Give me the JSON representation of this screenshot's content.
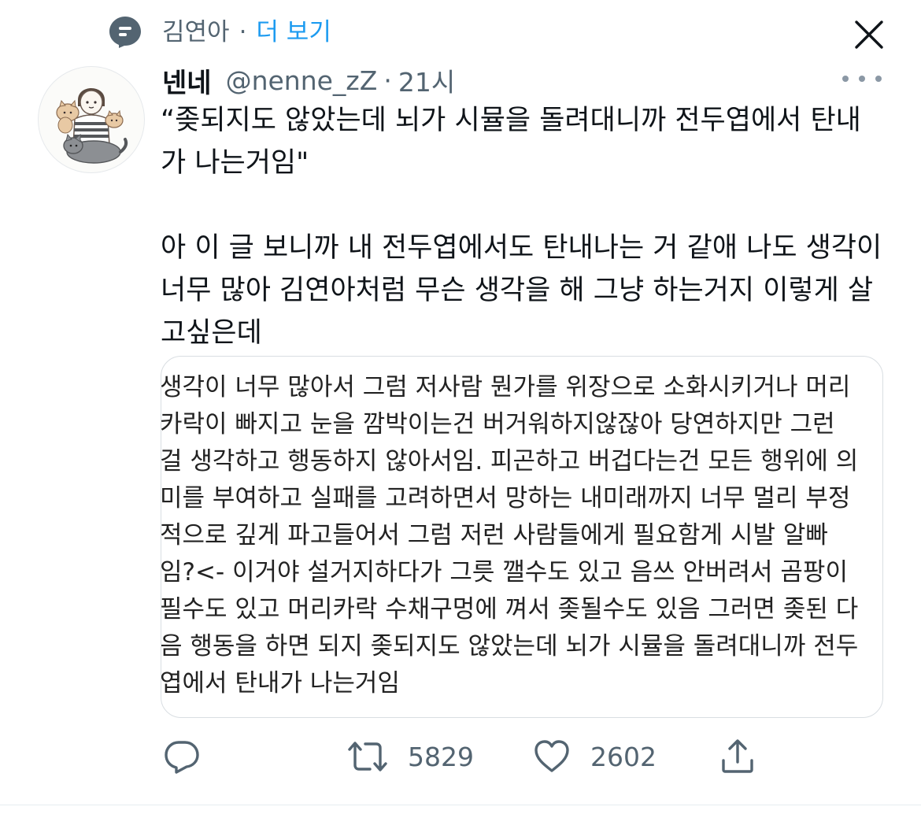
{
  "context": {
    "icon": "topic-icon",
    "name": "김연아",
    "dot": "·",
    "more_label": "더 보기"
  },
  "close": {
    "icon": "close-icon"
  },
  "author": {
    "display_name": "넨네",
    "handle": "@nenne_zZ",
    "separator": "·",
    "time": "21시",
    "avatar": "avatar-illustration"
  },
  "more": {
    "icon": "more-icon"
  },
  "tweet": {
    "paragraph_1": "“좆되지도 않았는데 뇌가 시뮬을 돌려대니까 전두엽에서 탄내가 나는거임\"",
    "paragraph_2": "아 이 글 보니까 내 전두엽에서도 탄내나는 거 같애 나도 생각이 너무 많아 김연아처럼 무슨 생각을 해 그냥 하는거지 이렇게 살고싶은데"
  },
  "media": {
    "lines": [
      "생각이 너무 많아서 그럼 저사람 뭔가를 위장으로 소화시키거나 머리",
      "카락이 빠지고 눈을 깜박이는건 버거워하지않잖아 당연하지만 그런",
      "걸 생각하고 행동하지 않아서임. 피곤하고 버겁다는건 모든 행위에 의",
      "미를 부여하고 실패를 고려하면서 망하는 내미래까지 너무 멀리 부정",
      "적으로 깊게 파고들어서 그럼 저런 사람들에게 필요함게 시발 알빠",
      "임?<- 이거야 설거지하다가 그릇 깰수도 있고 음쓰 안버려서 곰팡이",
      "필수도 있고 머리카락 수채구멍에 껴서 좆될수도 있음 그러면 좆된 다",
      "음 행동을 하면 되지 좆되지도 않았는데 뇌가 시뮬을 돌려대니까 전두",
      "엽에서 탄내가 나는거임"
    ]
  },
  "actions": {
    "reply": {
      "icon": "reply-icon"
    },
    "retweet": {
      "icon": "retweet-icon",
      "count": "5829"
    },
    "like": {
      "icon": "heart-icon",
      "count": "2602"
    },
    "share": {
      "icon": "share-icon"
    }
  },
  "colors": {
    "text_primary": "#0f1419",
    "text_secondary": "#536471",
    "accent": "#1d9bf0"
  }
}
